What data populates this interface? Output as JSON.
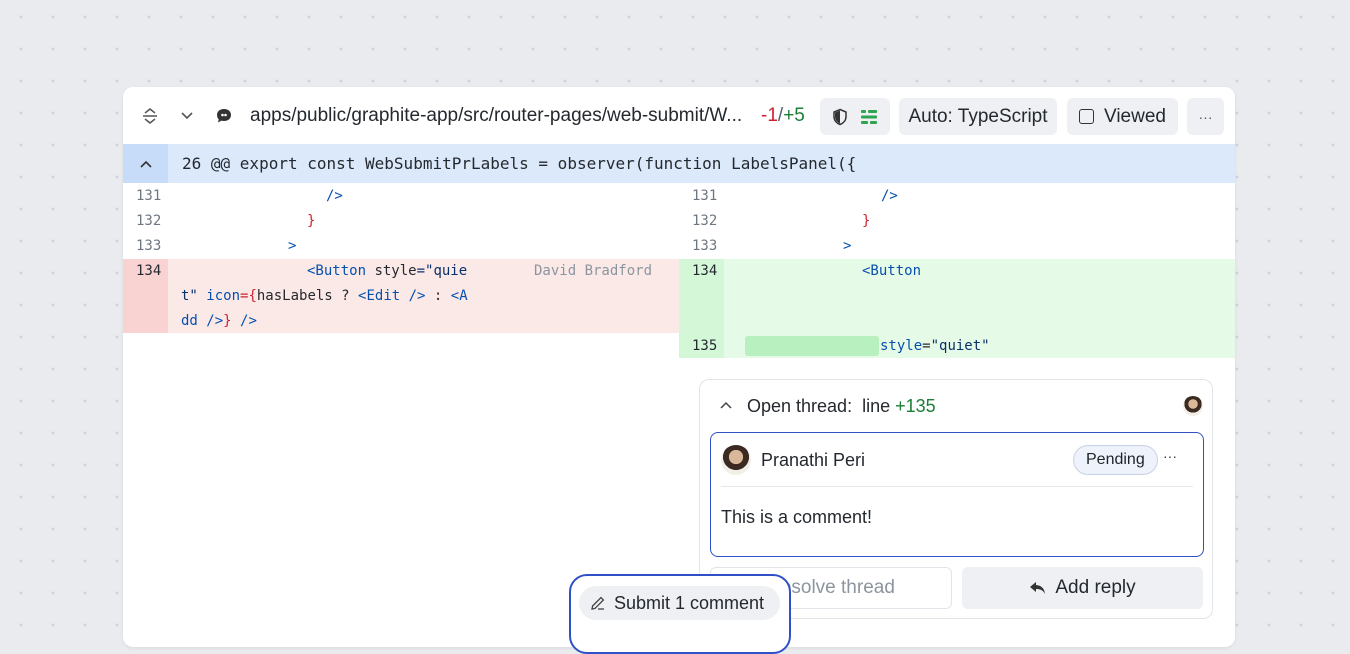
{
  "file_header": {
    "expand_icon": "expand-vertical-icon",
    "collapse_icon": "chevron-down-icon",
    "comment_icon": "comment-bubble-icon",
    "path": "apps/public/graphite-app/src/router-pages/web-submit/W...",
    "deletions": "-1",
    "separator": "/",
    "additions": "+5",
    "language_button": "Auto: TypeScript",
    "viewed_label": "Viewed",
    "more_label": "···"
  },
  "hunk": {
    "toggle_icon": "chevron-up-icon",
    "text": "26 @@ export const WebSubmitPrLabels = observer(function LabelsPanel({"
  },
  "left": {
    "lines": [
      {
        "num": "131",
        "code": "/>"
      },
      {
        "num": "132",
        "code": "}"
      },
      {
        "num": "133",
        "code": ">"
      }
    ],
    "removed": {
      "num": "134",
      "line1_a": "<Button",
      "line1_b": " style",
      "line1_c": "=\"quie",
      "blame": "David Bradford",
      "line2_a": "t\"",
      "line2_b": " icon",
      "line2_c": "={",
      "line2_d": "hasLabels ? ",
      "line2_e": "<Edit />",
      "line2_f": " : ",
      "line2_g": "<A",
      "line3_a": "dd />",
      "line3_b": "}",
      "line3_c": " />"
    }
  },
  "right": {
    "lines": [
      {
        "num": "131",
        "code": "/>"
      },
      {
        "num": "132",
        "code": "}"
      },
      {
        "num": "133",
        "code": ">"
      }
    ],
    "added": [
      {
        "num": "134",
        "code": "<Button"
      },
      {
        "num": "135",
        "attr": "style",
        "eq": "=",
        "value": "\"quiet\""
      }
    ]
  },
  "thread": {
    "toggle_icon": "chevron-up-icon",
    "title": "Open thread:",
    "line_label": "line",
    "line_ref": "+135",
    "author": "Pranathi Peri",
    "status": "Pending",
    "more": "···",
    "body": "This is a comment!",
    "resolve_label": "Resolve thread",
    "reply_icon": "reply-arrow-icon",
    "reply_label": "Add reply"
  },
  "submit": {
    "icon": "pencil-icon",
    "label": "Submit 1 comment"
  },
  "colors": {
    "removed_bg": "#fbe9e7",
    "removed_gutter": "#f8d3d2",
    "added_bg": "#e6fbe7",
    "added_gutter": "#d4f7d7",
    "hunk_bg": "#dce9fb",
    "accent": "#3050c8"
  }
}
